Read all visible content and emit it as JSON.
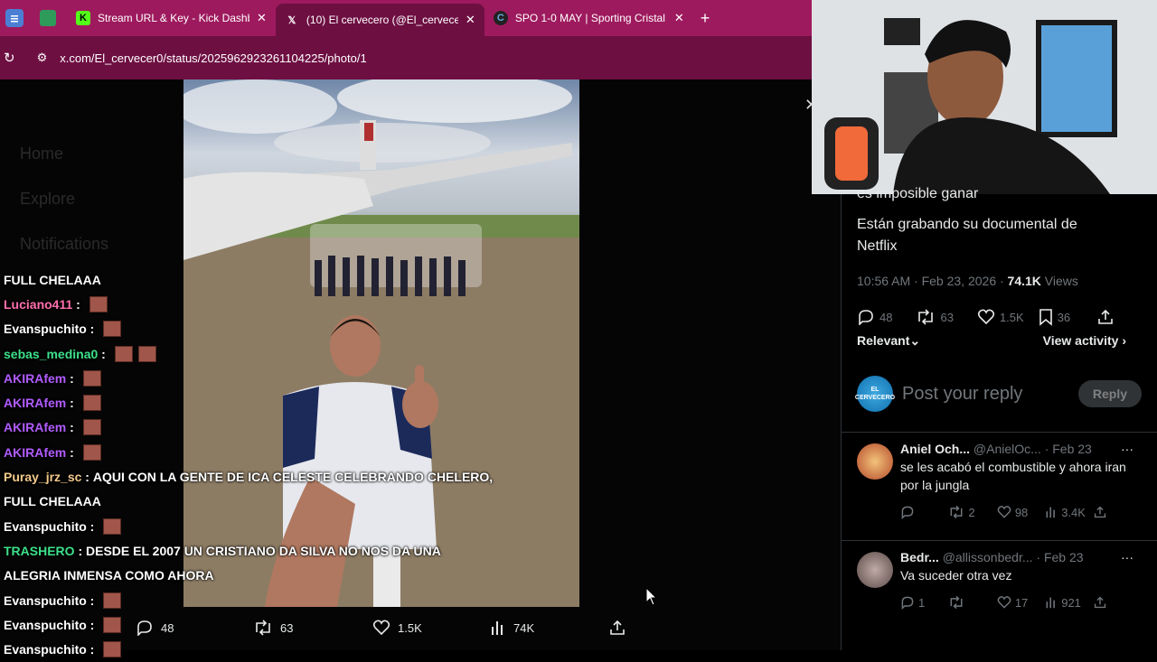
{
  "browser": {
    "tabs": [
      {
        "label": "Stream URL & Key - Kick Dashb"
      },
      {
        "label": "(10) El cervecero (@El_cervecer"
      },
      {
        "label": "SPO 1-0 MAY | Sporting Cristal"
      }
    ],
    "new_tab": "+",
    "close": "✕",
    "url": "x.com/El_cervecer0/status/2025962923261104225/photo/1"
  },
  "sidebar_ghost": [
    "Home",
    "Explore",
    "Notifications"
  ],
  "chat": [
    {
      "user": "",
      "text": "FULL CHELAAA",
      "color": "#ffffff",
      "emotes": 0
    },
    {
      "user": "Luciano411",
      "text": "",
      "color": "#ff6fae",
      "emotes": 1
    },
    {
      "user": "Evanspuchito",
      "text": "",
      "color": "#ffffff",
      "emotes": 1
    },
    {
      "user": "sebas_medina0",
      "text": "",
      "color": "#3de08a",
      "emotes": 2
    },
    {
      "user": "AKIRAfem",
      "text": "",
      "color": "#b15cff",
      "emotes": 1
    },
    {
      "user": "AKIRAfem",
      "text": "",
      "color": "#b15cff",
      "emotes": 1
    },
    {
      "user": "AKIRAfem",
      "text": "",
      "color": "#b15cff",
      "emotes": 1
    },
    {
      "user": "AKIRAfem",
      "text": "",
      "color": "#b15cff",
      "emotes": 1
    },
    {
      "user": "Puray_jrz_sc",
      "text": "AQUI CON LA GENTE DE ICA CELESTE CELEBRANDO CHELERO,",
      "color": "#f3c98b",
      "emotes": 0
    },
    {
      "user": "",
      "text": "FULL CHELAAA",
      "color": "#ffffff",
      "emotes": 0
    },
    {
      "user": "Evanspuchito",
      "text": "",
      "color": "#ffffff",
      "emotes": 1
    },
    {
      "user": "TRASHERO",
      "text": "DESDE EL 2007 UN CRISTIANO DA SILVA NO NOS DA UNA",
      "color": "#3de08a",
      "emotes": 0
    },
    {
      "user": "",
      "text": "ALEGRIA INMENSA COMO AHORA",
      "color": "#ffffff",
      "emotes": 0
    },
    {
      "user": "Evanspuchito",
      "text": "",
      "color": "#ffffff",
      "emotes": 1
    },
    {
      "user": "Evanspuchito",
      "text": "",
      "color": "#ffffff",
      "emotes": 1
    },
    {
      "user": "Evanspuchito",
      "text": "",
      "color": "#ffffff",
      "emotes": 1
    }
  ],
  "photo_actions": {
    "replies": "48",
    "reposts": "63",
    "likes": "1.5K",
    "views": "74K"
  },
  "tweet": {
    "partial_line": "es imposible ganar",
    "body": "Están grabando su documental de Netflix",
    "time": "10:56 AM · Feb 23, 2026 · ",
    "views_count": "74.1K",
    "views_label": " Views",
    "replies": "48",
    "reposts": "63",
    "likes": "1.5K",
    "bookmarks": "36",
    "relevant": "Relevant",
    "view_activity": "View activity",
    "reply_placeholder": "Post your reply",
    "reply_button": "Reply",
    "avatar_text": "EL CERVECERO"
  },
  "comments": [
    {
      "name": "Aniel Och...",
      "handle": "@AnielOc...",
      "date": "· Feb 23",
      "text": "se les acabó el combustible y ahora iran por la jungla",
      "reposts": "2",
      "likes": "98",
      "views": "3.4K"
    },
    {
      "name": "Bedr...",
      "handle": "@allissonbedr...",
      "date": "· Feb 23",
      "text": "Va suceder otra vez",
      "replies": "1",
      "likes": "17",
      "views": "921"
    }
  ]
}
